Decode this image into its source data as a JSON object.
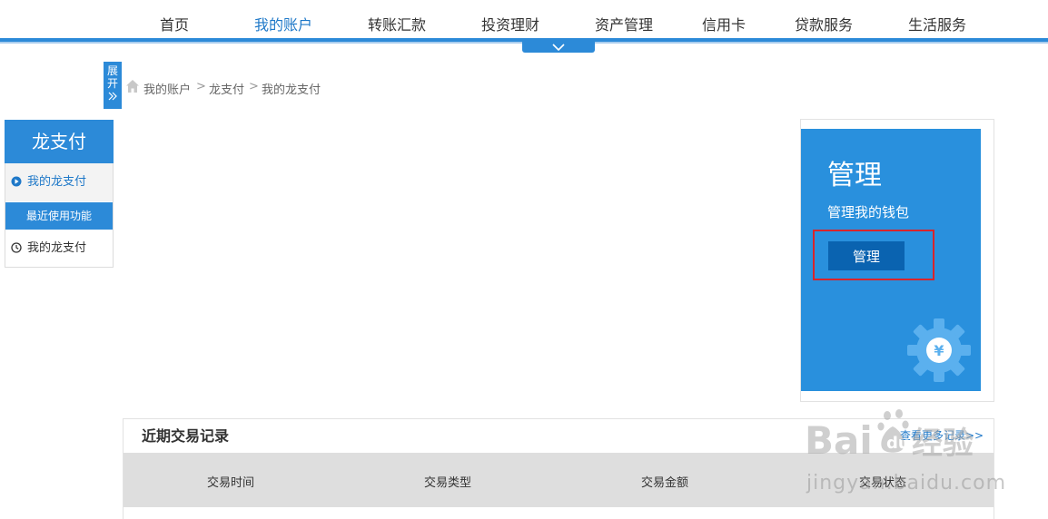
{
  "nav": {
    "items": [
      {
        "label": "首页",
        "active": false
      },
      {
        "label": "我的账户",
        "active": true
      },
      {
        "label": "转账汇款",
        "active": false
      },
      {
        "label": "投资理财",
        "active": false
      },
      {
        "label": "资产管理",
        "active": false
      },
      {
        "label": "信用卡",
        "active": false
      },
      {
        "label": "贷款服务",
        "active": false
      },
      {
        "label": "生活服务",
        "active": false
      }
    ],
    "accent_color": "#2c8ad8"
  },
  "expand_tag": {
    "label": "展开",
    "icon": "double-chevron-right-icon"
  },
  "breadcrumb": {
    "icon": "home-icon",
    "items": [
      "我的账户",
      "龙支付",
      "我的龙支付"
    ],
    "separator": ">"
  },
  "sidebar": {
    "title": "龙支付",
    "active_item": {
      "label": "我的龙支付",
      "icon": "play-circle-icon"
    },
    "section_label": "最近使用功能",
    "recent_item": {
      "label": "我的龙支付",
      "icon": "clock-icon"
    }
  },
  "manage_card": {
    "title": "管理",
    "subtitle": "管理我的钱包",
    "button_label": "管理",
    "icon": "gear-yuan-icon",
    "bg_color": "#2990dd",
    "highlight_color": "#d9242b"
  },
  "transactions": {
    "title": "近期交易记录",
    "more_link": "查看更多记录>>",
    "columns": [
      "交易时间",
      "交易类型",
      "交易金额",
      "交易状态"
    ]
  },
  "watermark": {
    "brand": "Baidu经验",
    "url": "jingyan.baidu.com"
  }
}
